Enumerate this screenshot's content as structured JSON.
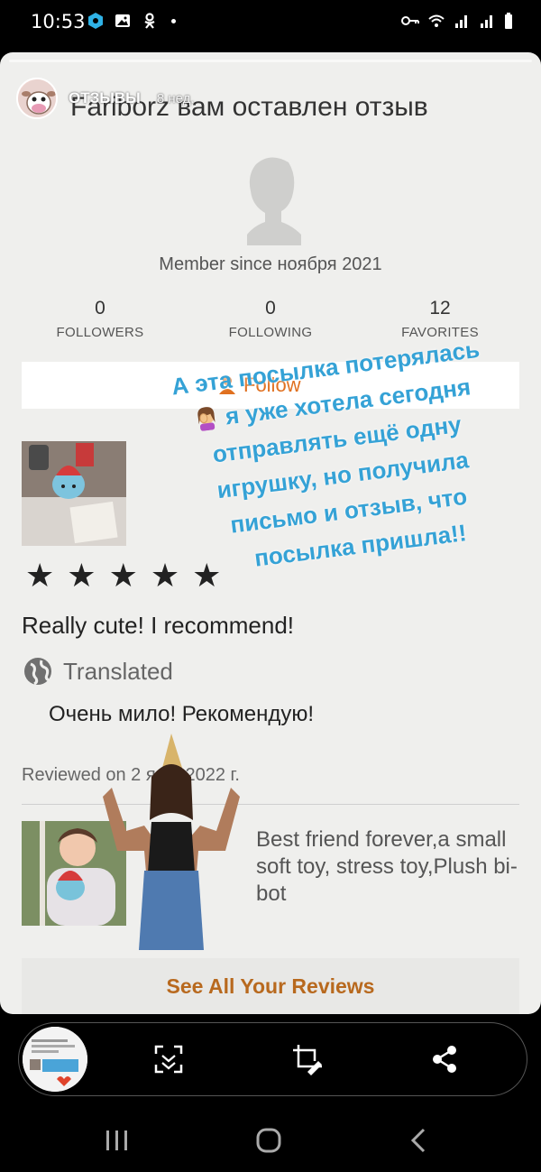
{
  "status_bar": {
    "time": "10:53"
  },
  "story": {
    "user": "ОТЗЫВЫ",
    "age": "8 нед."
  },
  "review_page": {
    "title": "Farіborz вам оставлен отзыв",
    "member_since": "Member since ноября 2021",
    "stats": [
      {
        "value": "0",
        "label": "FOLLOWERS"
      },
      {
        "value": "0",
        "label": "FOLLOWING"
      },
      {
        "value": "12",
        "label": "FAVORITES"
      }
    ],
    "follow_label": "Follow",
    "rating": 5,
    "review_text": "Really cute! I recommend!",
    "translated_label": "Translated",
    "translation_text": "Очень мило! Рекомендую!",
    "reviewed_date": "Reviewed on 2 янв. 2022 г.",
    "listing_title": "Best friend forever,a small soft toy, stress toy,Plush bi-bot",
    "see_all_label": "See All Your Reviews"
  },
  "overlay": {
    "lines": [
      "А эта посылка потерялась",
      "я уже хотела сегодня",
      "отправлять ещё одну",
      "игрушку, но получила",
      "письмо и отзыв, что",
      "посылка пришла!!"
    ],
    "color": "#35a2d6"
  },
  "colors": {
    "accent": "#e0701f",
    "see_all": "#b8691e"
  }
}
